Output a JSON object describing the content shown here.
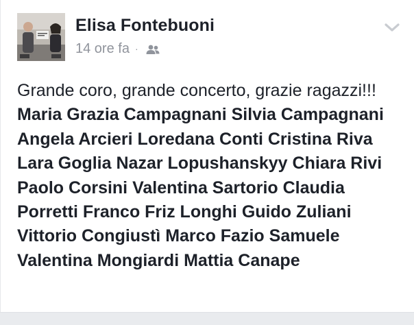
{
  "post": {
    "author": "Elisa Fontebuoni",
    "timestamp": "14 ore fa",
    "separator": "·",
    "audience_icon": "friends-icon",
    "menu_icon": "chevron-down-icon",
    "text": "Grande coro, grande concerto, grazie ragazzi!!!",
    "tagged_people": [
      "Maria Grazia Campagnani",
      "Silvia Campagnani",
      "Angela Arcieri",
      "Loredana Conti",
      "Cristina Riva",
      "Lara Goglia",
      "Nazar Lopushanskyy",
      "Chiara Rivi",
      "Paolo Corsini",
      "Valentina Sartorio",
      "Claudia Porretti",
      "Franco Friz Longhi",
      "Guido Zuliani",
      "Vittorio Congiustì",
      "Marco Fazio",
      "Samuele Valentina Mongiardi",
      "Mattia Canape"
    ]
  },
  "colors": {
    "text": "#1d2129",
    "meta": "#90949c",
    "background": "#ffffff",
    "footer": "#e9ebee"
  }
}
